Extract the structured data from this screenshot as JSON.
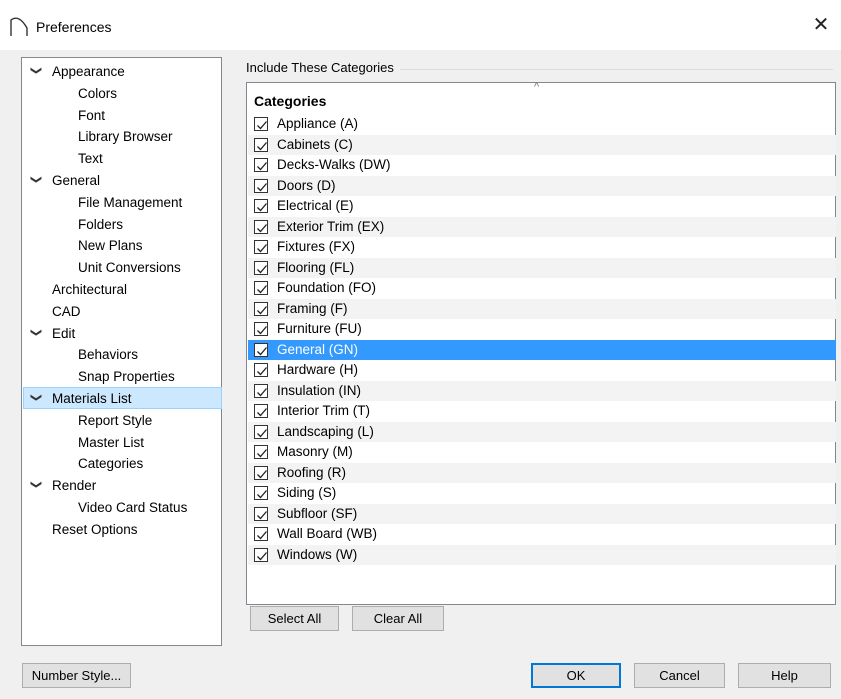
{
  "window": {
    "title": "Preferences",
    "close_glyph": "✕"
  },
  "tree": {
    "items": [
      {
        "label": "Appearance",
        "level": 0,
        "expanded": true
      },
      {
        "label": "Colors",
        "level": 1
      },
      {
        "label": "Font",
        "level": 1
      },
      {
        "label": "Library Browser",
        "level": 1
      },
      {
        "label": "Text",
        "level": 1
      },
      {
        "label": "General",
        "level": 0,
        "expanded": true
      },
      {
        "label": "File Management",
        "level": 1
      },
      {
        "label": "Folders",
        "level": 1
      },
      {
        "label": "New Plans",
        "level": 1
      },
      {
        "label": "Unit Conversions",
        "level": 1
      },
      {
        "label": "Architectural",
        "level": 0
      },
      {
        "label": "CAD",
        "level": 0
      },
      {
        "label": "Edit",
        "level": 0,
        "expanded": true
      },
      {
        "label": "Behaviors",
        "level": 1
      },
      {
        "label": "Snap Properties",
        "level": 1
      },
      {
        "label": "Materials List",
        "level": 0,
        "expanded": true,
        "selected": true
      },
      {
        "label": "Report Style",
        "level": 1
      },
      {
        "label": "Master List",
        "level": 1
      },
      {
        "label": "Categories",
        "level": 1
      },
      {
        "label": "Render",
        "level": 0,
        "expanded": true
      },
      {
        "label": "Video Card Status",
        "level": 1
      },
      {
        "label": "Reset Options",
        "level": 0
      }
    ]
  },
  "categories_group": {
    "title": "Include These Categories",
    "column_header": "Categories",
    "sort_glyph": "^",
    "rows": [
      {
        "label": "Appliance (A)",
        "checked": true
      },
      {
        "label": "Cabinets (C)",
        "checked": true
      },
      {
        "label": "Decks-Walks (DW)",
        "checked": true
      },
      {
        "label": "Doors (D)",
        "checked": true
      },
      {
        "label": "Electrical (E)",
        "checked": true
      },
      {
        "label": "Exterior Trim (EX)",
        "checked": true
      },
      {
        "label": "Fixtures (FX)",
        "checked": true
      },
      {
        "label": "Flooring (FL)",
        "checked": true
      },
      {
        "label": "Foundation (FO)",
        "checked": true
      },
      {
        "label": "Framing (F)",
        "checked": true
      },
      {
        "label": "Furniture (FU)",
        "checked": true
      },
      {
        "label": "General (GN)",
        "checked": true,
        "selected": true
      },
      {
        "label": "Hardware (H)",
        "checked": true
      },
      {
        "label": "Insulation (IN)",
        "checked": true
      },
      {
        "label": "Interior Trim (T)",
        "checked": true
      },
      {
        "label": "Landscaping (L)",
        "checked": true
      },
      {
        "label": "Masonry (M)",
        "checked": true
      },
      {
        "label": "Roofing (R)",
        "checked": true
      },
      {
        "label": "Siding (S)",
        "checked": true
      },
      {
        "label": "Subfloor (SF)",
        "checked": true
      },
      {
        "label": "Wall Board (WB)",
        "checked": true
      },
      {
        "label": "Windows (W)",
        "checked": true
      }
    ]
  },
  "buttons": {
    "select_all": "Select All",
    "clear_all": "Clear All",
    "number_style": "Number Style...",
    "ok": "OK",
    "cancel": "Cancel",
    "help": "Help"
  },
  "colors": {
    "selection": "#3399ff",
    "tree_selection": "#cce8ff",
    "dialog_bg": "#f0f0f0"
  }
}
